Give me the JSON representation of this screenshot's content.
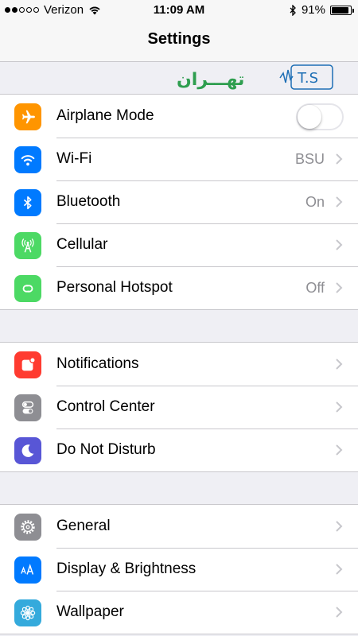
{
  "status_bar": {
    "carrier": "Verizon",
    "time": "11:09 AM",
    "battery": "91%",
    "battery_level": 0.91,
    "signal_bars_filled": 2,
    "signal_bars_total": 5
  },
  "nav": {
    "title": "Settings"
  },
  "watermark": {
    "text": "تهران",
    "text2": "T.S"
  },
  "groups": [
    {
      "rows": [
        {
          "label": "Airplane Mode",
          "icon": "airplane-icon",
          "color": "#ff9500",
          "toggle": false
        },
        {
          "label": "Wi-Fi",
          "icon": "wifi-icon",
          "color": "#007aff",
          "value": "BSU"
        },
        {
          "label": "Bluetooth",
          "icon": "bluetooth-icon",
          "color": "#007aff",
          "value": "On"
        },
        {
          "label": "Cellular",
          "icon": "cellular-icon",
          "color": "#4cd964",
          "value": ""
        },
        {
          "label": "Personal Hotspot",
          "icon": "hotspot-icon",
          "color": "#4cd964",
          "value": "Off"
        }
      ]
    },
    {
      "rows": [
        {
          "label": "Notifications",
          "icon": "notifications-icon",
          "color": "#ff3b30"
        },
        {
          "label": "Control Center",
          "icon": "control-center-icon",
          "color": "#8e8e93"
        },
        {
          "label": "Do Not Disturb",
          "icon": "moon-icon",
          "color": "#5856d6"
        }
      ]
    },
    {
      "rows": [
        {
          "label": "General",
          "icon": "gear-icon",
          "color": "#8e8e93"
        },
        {
          "label": "Display & Brightness",
          "icon": "text-size-icon",
          "color": "#007aff"
        },
        {
          "label": "Wallpaper",
          "icon": "flower-icon",
          "color": "#34aadc"
        }
      ]
    }
  ],
  "colors": {
    "background": "#efeff4",
    "separator": "#c8c7cc",
    "secondary_text": "#8e8e93"
  }
}
